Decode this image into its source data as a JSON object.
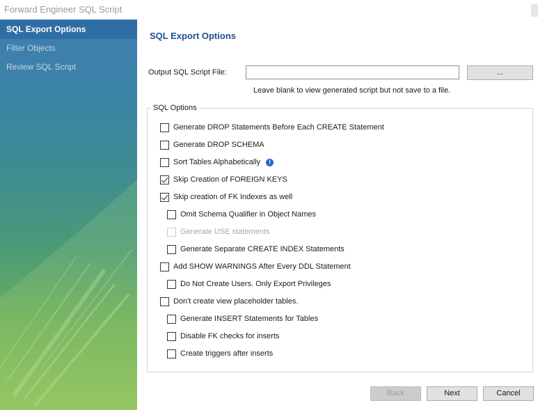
{
  "window": {
    "title": "Forward Engineer SQL Script"
  },
  "sidebar": {
    "items": [
      {
        "label": "SQL Export Options",
        "active": true
      },
      {
        "label": "Filter Objects",
        "active": false
      },
      {
        "label": "Review SQL Script",
        "active": false
      }
    ]
  },
  "main": {
    "heading": "SQL Export Options",
    "output": {
      "label": "Output SQL Script File:",
      "value": "",
      "browse_label": "...",
      "hint": "Leave blank to view generated script but not save to a file."
    },
    "group_title": "SQL Options",
    "options": [
      {
        "label": "Generate DROP Statements Before Each CREATE Statement",
        "checked": false,
        "disabled": false
      },
      {
        "label": "Generate DROP SCHEMA",
        "checked": false,
        "disabled": false
      },
      {
        "label": "Sort Tables Alphabetically",
        "checked": false,
        "disabled": false,
        "icon": "info-icon"
      },
      {
        "label": "Skip Creation of FOREIGN KEYS",
        "checked": true,
        "disabled": false
      },
      {
        "label": "Skip creation of FK Indexes as well",
        "checked": true,
        "disabled": false
      },
      {
        "label": "Omit Schema Qualifier in Object Names",
        "checked": false,
        "disabled": false
      },
      {
        "label": "Generate USE statements",
        "checked": false,
        "disabled": true
      },
      {
        "label": "Generate Separate CREATE INDEX Statements",
        "checked": false,
        "disabled": false
      },
      {
        "label": "Add SHOW WARNINGS After Every DDL Statement",
        "checked": false,
        "disabled": false
      },
      {
        "label": "Do Not Create Users. Only Export Privileges",
        "checked": false,
        "disabled": false
      },
      {
        "label": "Don't create view placeholder tables.",
        "checked": false,
        "disabled": false
      },
      {
        "label": "Generate INSERT Statements for Tables",
        "checked": false,
        "disabled": false
      },
      {
        "label": "Disable FK checks for inserts",
        "checked": false,
        "disabled": false
      },
      {
        "label": "Create triggers after inserts",
        "checked": false,
        "disabled": false
      }
    ]
  },
  "footer": {
    "back_label": "Back",
    "next_label": "Next",
    "cancel_label": "Cancel"
  }
}
